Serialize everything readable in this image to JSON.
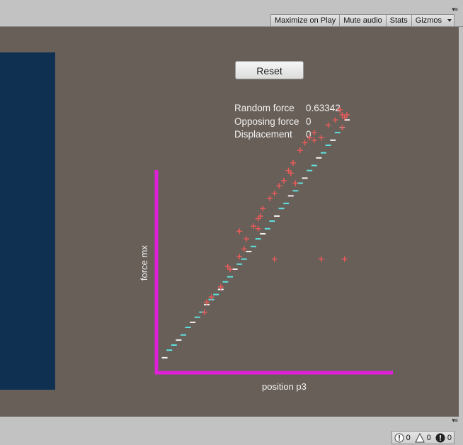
{
  "toolbar": {
    "buttons": [
      {
        "label": "Maximize on Play"
      },
      {
        "label": "Mute audio"
      },
      {
        "label": "Stats"
      },
      {
        "label": "Gizmos"
      }
    ],
    "menu_icon": "tab-menu-icon",
    "dropdown_icon": "chevron-down-icon"
  },
  "game": {
    "reset_label": "Reset",
    "random_force_label": "Random force",
    "random_force_value": "0.63342",
    "opposing_force_label": "Opposing force",
    "opposing_force_value": "0",
    "displacement_label": "Displacement",
    "displacement_value": "0",
    "colors": {
      "background": "#685f58",
      "panel": "#0f3050",
      "axes": "#e020d8",
      "marker_red": "#f05a5a",
      "marker_cyan": "#5fe0e0",
      "marker_white": "#f2f2f2"
    }
  },
  "chart_data": {
    "type": "scatter",
    "xlabel": "position p3",
    "ylabel": "force mx",
    "series": [
      {
        "marker": "dash",
        "color": "cyan-white",
        "points": [
          [
            0.02,
            0.02
          ],
          [
            0.04,
            0.05
          ],
          [
            0.06,
            0.07
          ],
          [
            0.08,
            0.09
          ],
          [
            0.1,
            0.11
          ],
          [
            0.12,
            0.14
          ],
          [
            0.14,
            0.16
          ],
          [
            0.16,
            0.18
          ],
          [
            0.18,
            0.2
          ],
          [
            0.2,
            0.23
          ],
          [
            0.22,
            0.25
          ],
          [
            0.24,
            0.27
          ],
          [
            0.26,
            0.29
          ],
          [
            0.28,
            0.32
          ],
          [
            0.3,
            0.34
          ],
          [
            0.32,
            0.37
          ],
          [
            0.34,
            0.39
          ],
          [
            0.36,
            0.41
          ],
          [
            0.38,
            0.44
          ],
          [
            0.4,
            0.46
          ],
          [
            0.42,
            0.49
          ],
          [
            0.44,
            0.51
          ],
          [
            0.46,
            0.53
          ],
          [
            0.48,
            0.56
          ],
          [
            0.5,
            0.58
          ],
          [
            0.52,
            0.61
          ],
          [
            0.54,
            0.63
          ],
          [
            0.56,
            0.66
          ],
          [
            0.58,
            0.68
          ],
          [
            0.6,
            0.71
          ],
          [
            0.62,
            0.73
          ],
          [
            0.64,
            0.76
          ],
          [
            0.66,
            0.78
          ],
          [
            0.68,
            0.81
          ],
          [
            0.7,
            0.83
          ],
          [
            0.72,
            0.86
          ],
          [
            0.74,
            0.88
          ],
          [
            0.76,
            0.91
          ],
          [
            0.78,
            0.93
          ],
          [
            0.8,
            0.96
          ]
        ]
      },
      {
        "marker": "plus",
        "color": "red",
        "points": [
          [
            0.19,
            0.2
          ],
          [
            0.2,
            0.24
          ],
          [
            0.22,
            0.26
          ],
          [
            0.26,
            0.3
          ],
          [
            0.3,
            0.37
          ],
          [
            0.34,
            0.42
          ],
          [
            0.36,
            0.45
          ],
          [
            0.37,
            0.49
          ],
          [
            0.4,
            0.54
          ],
          [
            0.42,
            0.57
          ],
          [
            0.44,
            0.61
          ],
          [
            0.47,
            0.65
          ],
          [
            0.49,
            0.67
          ],
          [
            0.51,
            0.7
          ],
          [
            0.53,
            0.72
          ],
          [
            0.55,
            0.76
          ],
          [
            0.57,
            0.79
          ],
          [
            0.6,
            0.84
          ],
          [
            0.62,
            0.87
          ],
          [
            0.64,
            0.89
          ],
          [
            0.66,
            0.91
          ],
          [
            0.72,
            0.94
          ],
          [
            0.75,
            0.96
          ],
          [
            0.77,
            1.0
          ],
          [
            0.78,
            0.98
          ],
          [
            0.79,
            0.97
          ],
          [
            0.8,
            0.98
          ],
          [
            0.78,
            0.93
          ],
          [
            0.69,
            0.89
          ],
          [
            0.66,
            0.88
          ],
          [
            0.56,
            0.75
          ],
          [
            0.58,
            0.71
          ],
          [
            0.43,
            0.58
          ],
          [
            0.42,
            0.53
          ],
          [
            0.34,
            0.52
          ],
          [
            0.29,
            0.38
          ],
          [
            0.49,
            0.41
          ],
          [
            0.69,
            0.41
          ],
          [
            0.79,
            0.41
          ]
        ]
      }
    ]
  },
  "status": {
    "info_count": "0",
    "warning_count": "0",
    "error_count": "0"
  }
}
